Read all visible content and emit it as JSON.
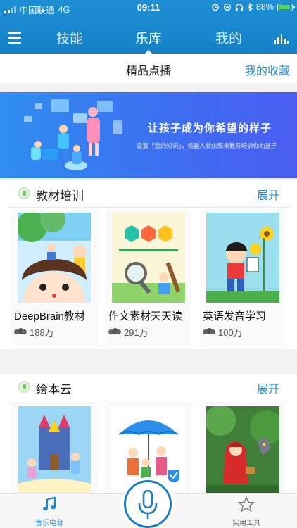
{
  "status": {
    "carrier": "中国联通",
    "network": "4G",
    "time": "09:11",
    "battery": "88%"
  },
  "nav": {
    "tabs": [
      "技能",
      "乐库",
      "我的"
    ],
    "active_index": 1
  },
  "subbar": {
    "title": "精品点播",
    "favorites": "我的收藏"
  },
  "banner": {
    "headline": "让孩子成为你希望的样子",
    "subtitle": "设置「我的知识」，机器人就依照来教导培训你的孩子"
  },
  "sections": [
    {
      "name": "教材培训",
      "more": "展开",
      "cards": [
        {
          "title": "DeepBrain教材",
          "count": "188万"
        },
        {
          "title": "作文素材天天读",
          "count": "291万"
        },
        {
          "title": "英语发音学习",
          "count": "100万"
        }
      ]
    },
    {
      "name": "绘本云",
      "more": "展开",
      "cards": [
        {},
        {},
        {}
      ]
    }
  ],
  "tabbar": {
    "left": "音乐电台",
    "right": "实用工具"
  },
  "colors": {
    "brand": "#1e8fd4",
    "link": "#2a8bd1",
    "banner_start": "#2f8ef0",
    "banner_end": "#4a5ef2"
  }
}
